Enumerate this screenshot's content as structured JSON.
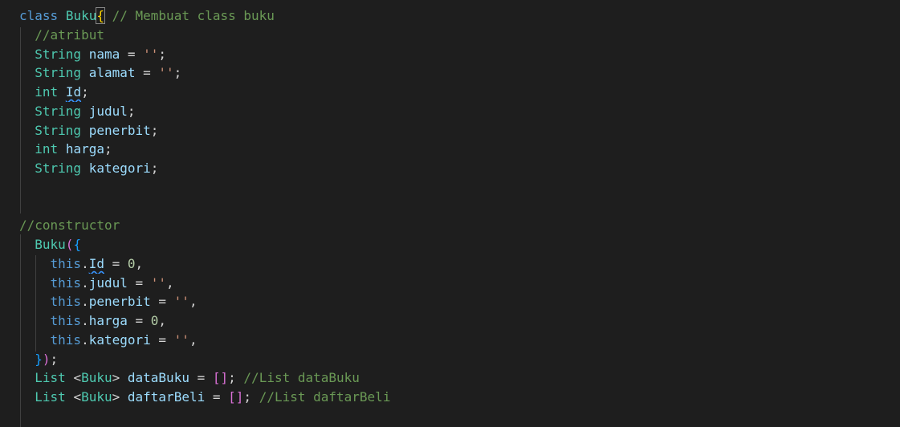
{
  "code": {
    "line1": {
      "kw_class": "class",
      "class_name": "Buku",
      "open_brace": "{",
      "comment": "// Membuat class buku"
    },
    "line2": {
      "comment": "//atribut"
    },
    "line3": {
      "type": "String",
      "name": "nama",
      "eq": " = ",
      "value": "''",
      "end": ";"
    },
    "line4": {
      "type": "String",
      "name": "alamat",
      "eq": " = ",
      "value": "''",
      "end": ";"
    },
    "line5": {
      "type": "int",
      "name": "Id",
      "end": ";"
    },
    "line6": {
      "type": "String",
      "name": "judul",
      "end": ";"
    },
    "line7": {
      "type": "String",
      "name": "penerbit",
      "end": ";"
    },
    "line8": {
      "type": "int",
      "name": "harga",
      "end": ";"
    },
    "line9": {
      "type": "String",
      "name": "kategori",
      "end": ";"
    },
    "line12": {
      "comment": "//constructor"
    },
    "line13": {
      "name": "Buku",
      "paren": "(",
      "brace": "{"
    },
    "line14": {
      "this": "this",
      "dot": ".",
      "field": "Id",
      "eq": " = ",
      "value": "0",
      "end": ","
    },
    "line15": {
      "this": "this",
      "dot": ".",
      "field": "judul",
      "eq": " = ",
      "value": "''",
      "end": ","
    },
    "line16": {
      "this": "this",
      "dot": ".",
      "field": "penerbit",
      "eq": " = ",
      "value": "''",
      "end": ","
    },
    "line17": {
      "this": "this",
      "dot": ".",
      "field": "harga",
      "eq": " = ",
      "value": "0",
      "end": ","
    },
    "line18": {
      "this": "this",
      "dot": ".",
      "field": "kategori",
      "eq": " = ",
      "value": "''",
      "end": ","
    },
    "line19": {
      "brace": "}",
      "paren": ")",
      "end": ";"
    },
    "line20": {
      "type": "List",
      "lt": "<",
      "generic": "Buku",
      "gt": ">",
      "name": "dataBuku",
      "eq": " = ",
      "bracket_open": "[",
      "bracket_close": "]",
      "end": ";",
      "comment": "//List dataBuku"
    },
    "line21": {
      "type": "List",
      "lt": "<",
      "generic": "Buku",
      "gt": ">",
      "name": "daftarBeli",
      "eq": " = ",
      "bracket_open": "[",
      "bracket_close": "]",
      "end": ";",
      "comment": "//List daftarBeli"
    }
  },
  "colors": {
    "background": "#1e1e1e",
    "keyword": "#569cd6",
    "type": "#4ec9b0",
    "variable": "#9cdcfe",
    "comment": "#6a9955",
    "string": "#ce9178",
    "number": "#b5cea8",
    "bracket_level1": "#ffd700",
    "bracket_level2": "#da70d6",
    "bracket_level3": "#179fff"
  }
}
